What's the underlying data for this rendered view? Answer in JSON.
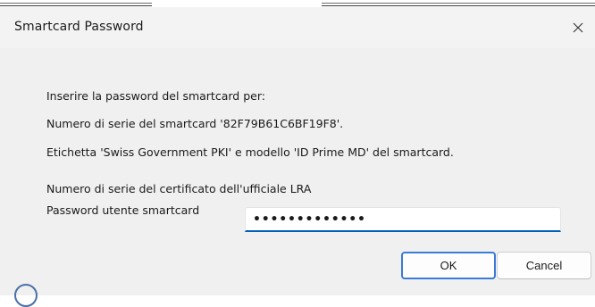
{
  "dialog": {
    "title": "Smartcard Password",
    "close_icon": "close-icon",
    "lines": [
      "Inserire la password del smartcard per:",
      "Numero di serie del smartcard '82F79B61C6BF19F8'.",
      "Etichetta 'Swiss Government PKI' e modello 'ID Prime MD' del smartcard.",
      "Numero di serie del certificato dell'ufficiale LRA"
    ],
    "password_label": "Password utente smartcard",
    "password_value": "•••••••••••••",
    "ok_label": "OK",
    "cancel_label": "Cancel",
    "accent_color": "#005fb8"
  }
}
